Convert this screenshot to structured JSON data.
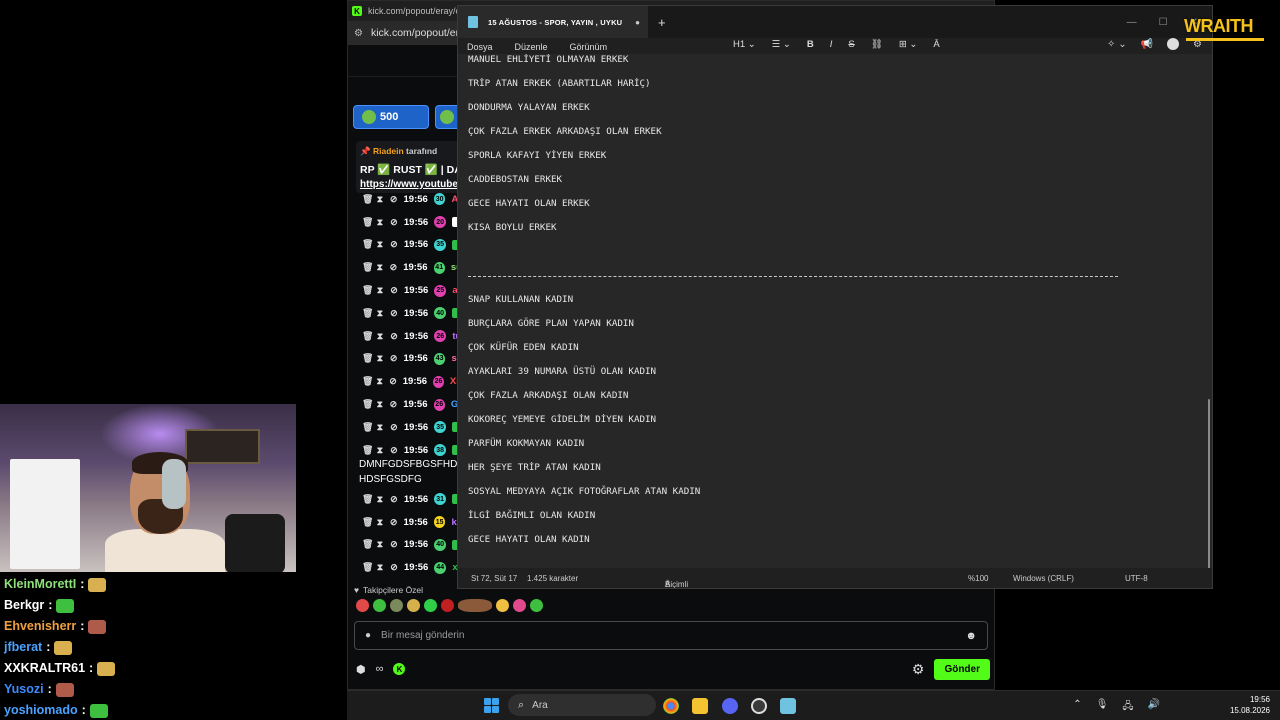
{
  "stream_chat": [
    {
      "user": "KleinMorettI",
      "color": "#8fe07a"
    },
    {
      "user": "Berkgr",
      "color": "#ffffff"
    },
    {
      "user": "Ehvenisherr",
      "color": "#f0a040"
    },
    {
      "user": "jfberat",
      "color": "#4aa3ff"
    },
    {
      "user": "XXKRALTR61",
      "color": "#ffffff"
    },
    {
      "user": "Yusozi",
      "color": "#3d8bff"
    },
    {
      "user": "yoshiomado",
      "color": "#4aa3ff"
    }
  ],
  "browser": {
    "tab_url": "kick.com/popout/eray/cha",
    "address": "kick.com/popout/era",
    "pill_value": "500",
    "pinned": {
      "name": "Riadein",
      "suffix": "tarafınd",
      "line2": "RP ✅ RUST ✅ | DAD",
      "link": "https://www.youtube"
    },
    "chat_rows": [
      {
        "time": "19:56",
        "badge": "#40d4d0",
        "badge_text": "30",
        "color": "#ff4b6e",
        "name": "Ar"
      },
      {
        "time": "19:56",
        "badge": "#e040b0",
        "badge_text": "20",
        "color": "#ffffff",
        "name": ""
      },
      {
        "time": "19:56",
        "badge": "#40d4d0",
        "badge_text": "35",
        "color": "#2fbf4a",
        "name": ""
      },
      {
        "time": "19:56",
        "badge": "#4ad070",
        "badge_text": "41",
        "color": "#8fe07a",
        "name": "su"
      },
      {
        "time": "19:56",
        "badge": "#e040b0",
        "badge_text": "25",
        "color": "#ff4b6e",
        "name": "ar"
      },
      {
        "time": "19:56",
        "badge": "#4ad070",
        "badge_text": "40",
        "color": "#2fbf4a",
        "name": ""
      },
      {
        "time": "19:56",
        "badge": "#e040b0",
        "badge_text": "26",
        "color": "#c070ff",
        "name": "tu"
      },
      {
        "time": "19:56",
        "badge": "#4ad070",
        "badge_text": "43",
        "color": "#ff6b9a",
        "name": "se"
      },
      {
        "time": "19:56",
        "badge": "#e040b0",
        "badge_text": "26",
        "color": "#ff4b4b",
        "name": "XL"
      },
      {
        "time": "19:56",
        "badge": "#e040b0",
        "badge_text": "26",
        "color": "#4aa3ff",
        "name": "Gr"
      },
      {
        "time": "19:56",
        "badge": "#40d4d0",
        "badge_text": "35",
        "color": "#2fbf4a",
        "name": ""
      },
      {
        "time": "19:56",
        "badge": "#40d4d0",
        "badge_text": "38",
        "color": "#2fbf4a",
        "name": ""
      }
    ],
    "chat_message_1": "DMNFGDSFBGSFHDL",
    "chat_message_2": "HDSFGSDFG",
    "chat_rows2": [
      {
        "time": "19:56",
        "badge": "#40d4d0",
        "badge_text": "31",
        "color": "#2fbf4a",
        "name": ""
      },
      {
        "time": "19:56",
        "badge": "#f4d020",
        "badge_text": "15",
        "color": "#c070ff",
        "name": "ka"
      },
      {
        "time": "19:56",
        "badge": "#4ad070",
        "badge_text": "40",
        "color": "#2fbf4a",
        "name": ""
      },
      {
        "time": "19:56",
        "badge": "#4ad070",
        "badge_text": "44",
        "color": "#2fbf4a",
        "name": "xt"
      }
    ],
    "followers_label": "Takipçilere Özel",
    "message_placeholder": "Bir mesaj gönderin",
    "send_label": "Gönder"
  },
  "notepad": {
    "tab_title": "15 AĞUSTOS - SPOR, YAYIN , UYKU",
    "menus": [
      "Dosya",
      "Düzenle",
      "Görünüm"
    ],
    "heading_label": "H1",
    "lines": [
      "MANUEL EHLİYETİ OLMAYAN ERKEK",
      "TRİP ATAN ERKEK (ABARTILAR HARİÇ)",
      "DONDURMA YALAYAN ERKEK",
      "ÇOK FAZLA ERKEK ARKADAŞI OLAN ERKEK",
      "SPORLA KAFAYI YİYEN ERKEK",
      "CADDEBOSTAN ERKEK",
      "GECE HAYATI OLAN ERKEK",
      "KISA BOYLU ERKEK",
      "",
      "---",
      "SNAP KULLANAN KADIN",
      "BURÇLARA GÖRE PLAN YAPAN KADIN",
      "ÇOK KÜFÜR EDEN KADIN",
      "AYAKLARI 39 NUMARA ÜSTÜ OLAN KADIN",
      "ÇOK FAZLA ARKADAŞI OLAN KADIN",
      "KOKOREÇ YEMEYE GİDELİM DİYEN KADIN",
      "PARFÜM KOKMAYAN KADIN",
      "HER ŞEYE TRİP ATAN KADIN",
      "SOSYAL MEDYAYA AÇIK FOTOĞRAFLAR ATAN KADIN",
      "İLGİ BAĞIMLI OLAN KADIN",
      "GECE HAYATI OLAN KADIN"
    ],
    "status": {
      "position": "St 72, Süt 17",
      "chars": "1.425 karakter",
      "format": "Biçimli",
      "zoom": "%100",
      "eol": "Windows (CRLF)",
      "encoding": "UTF-8"
    }
  },
  "logo": "WRAITH",
  "taskbar": {
    "search_placeholder": "Ara",
    "time": "19:56",
    "date": "15.08.2026"
  }
}
